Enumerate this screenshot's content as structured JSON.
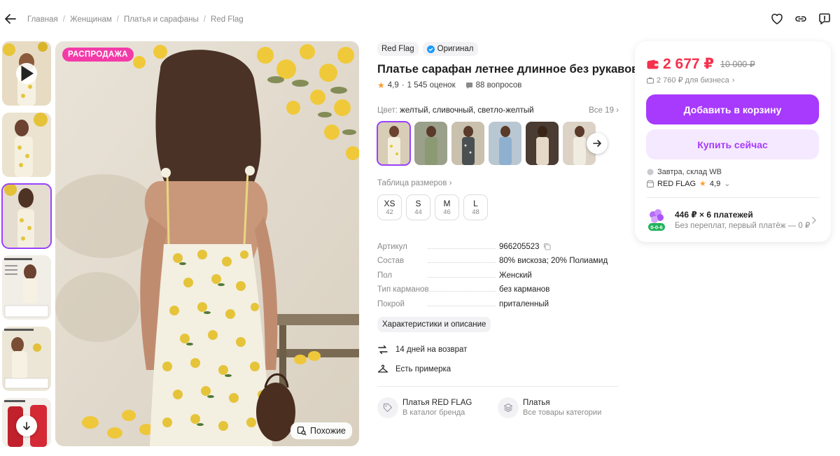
{
  "breadcrumb": [
    "Главная",
    "Женщинам",
    "Платья и сарафаны",
    "Red Flag"
  ],
  "main_photo": {
    "badge": "РАСПРОДАЖА",
    "similar_label": "Похожие"
  },
  "product": {
    "brand": "Red Flag",
    "original_label": "Оригинал",
    "title": "Платье сарафан летнее длинное без рукавов",
    "rating": "4,9",
    "reviews": "1 545 оценок",
    "questions": "88 вопросов",
    "color_label": "Цвет:",
    "color_value": "желтый, сливочный, светло-желтый",
    "all_colors": "Все 19",
    "size_table": "Таблица размеров",
    "sizes": [
      {
        "label": "XS",
        "ru": "42"
      },
      {
        "label": "S",
        "ru": "44"
      },
      {
        "label": "M",
        "ru": "46"
      },
      {
        "label": "L",
        "ru": "48"
      }
    ],
    "specs": [
      {
        "k": "Артикул",
        "v": "966205523"
      },
      {
        "k": "Состав",
        "v": "80% вискоза; 20% Полиамид"
      },
      {
        "k": "Пол",
        "v": "Женский"
      },
      {
        "k": "Тип карманов",
        "v": "без карманов"
      },
      {
        "k": "Покрой",
        "v": "приталенный"
      }
    ],
    "description_button": "Характеристики и описание",
    "features": [
      "14 дней на возврат",
      "Есть примерка"
    ],
    "links": [
      {
        "t1": "Платья RED FLAG",
        "t2": "В каталог бренда"
      },
      {
        "t1": "Платья",
        "t2": "Все товары категории"
      }
    ]
  },
  "panel": {
    "price": "2 677 ₽",
    "old_price": "10 000 ₽",
    "business_price": "2 760 ₽ для бизнеса",
    "add_to_cart": "Добавить в корзину",
    "buy_now": "Купить сейчас",
    "delivery": "Завтра, склад WB",
    "seller": "RED FLAG",
    "seller_rating": "4,9",
    "installment_title": "446 ₽ × 6 платежей",
    "installment_sub": "Без переплат, первый платёж — 0 ₽",
    "installment_badge": "0-0-6"
  },
  "colors": {
    "accent": "#a73afd",
    "price": "#f5314d",
    "sale_badge": "#f33ba8",
    "star": "#ff9b2f"
  }
}
